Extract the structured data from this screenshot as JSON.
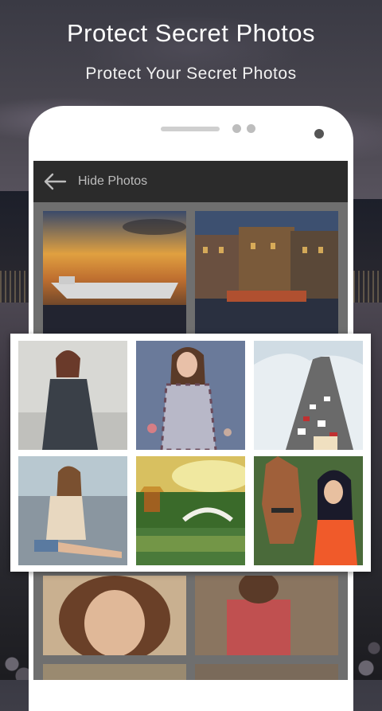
{
  "header": {
    "title": "Protect Secret Photos",
    "subtitle": "Protect Your Secret Photos"
  },
  "phone_screen": {
    "appbar": {
      "back_icon": "arrow-left-icon",
      "title": "Hide Photos"
    }
  },
  "colors": {
    "appbar_bg": "#2b2b2b",
    "appbar_text": "#bdbdbd",
    "card_bg": "#ffffff",
    "phone_body": "#ffffff"
  }
}
